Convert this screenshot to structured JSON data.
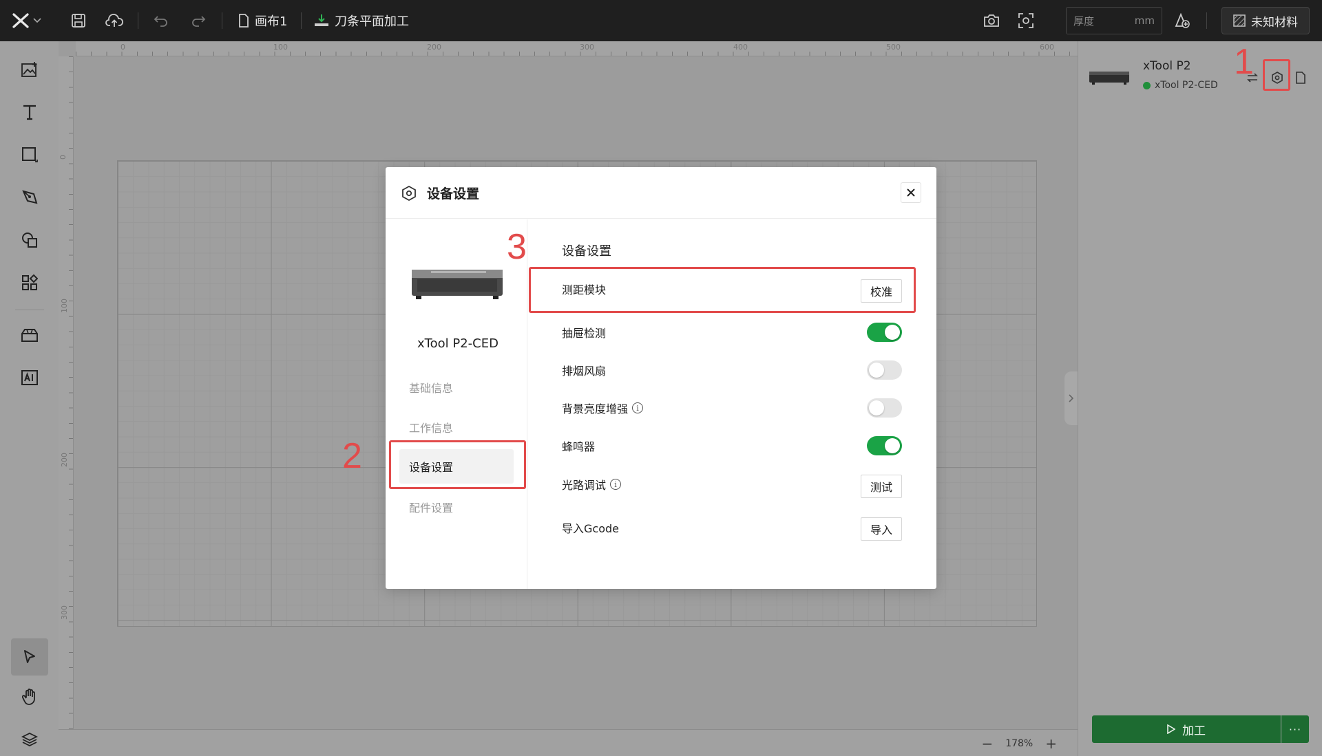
{
  "toolbar": {
    "canvas_name": "画布1",
    "mode_name": "刀条平面加工",
    "thickness_placeholder": "厚度",
    "thickness_unit": "mm",
    "material_label": "未知材料"
  },
  "ruler": {
    "top_ticks": [
      "0",
      "100",
      "200",
      "300",
      "400",
      "500",
      "600"
    ],
    "left_ticks": [
      "0",
      "100",
      "200",
      "300"
    ]
  },
  "status": {
    "zoom": "178%",
    "zoom_out": "−",
    "zoom_in": "+"
  },
  "device_panel": {
    "model": "xTool P2",
    "connected_device": "xTool P2-CED",
    "status_color": "#1f8f3a",
    "process_label": "加工",
    "more_label": "···"
  },
  "dialog": {
    "title": "设备设置",
    "device_name": "xTool P2-CED",
    "nav": [
      "基础信息",
      "工作信息",
      "设备设置",
      "配件设置"
    ],
    "active_nav": "设备设置",
    "section_title": "设备设置",
    "rows": [
      {
        "label": "测距模块",
        "control": "button",
        "button_label": "校准"
      },
      {
        "label": "抽屉检测",
        "control": "toggle",
        "on": true
      },
      {
        "label": "排烟风扇",
        "control": "toggle",
        "on": false
      },
      {
        "label": "背景亮度增强",
        "control": "toggle",
        "on": false,
        "info": true
      },
      {
        "label": "蜂鸣器",
        "control": "toggle",
        "on": true
      },
      {
        "label": "光路调试",
        "control": "button",
        "button_label": "测试",
        "info": true
      },
      {
        "label": "导入Gcode",
        "control": "button",
        "button_label": "导入"
      }
    ]
  },
  "annotations": {
    "step1": "1",
    "step2": "2",
    "step3": "3",
    "color": "#e24b4b"
  }
}
